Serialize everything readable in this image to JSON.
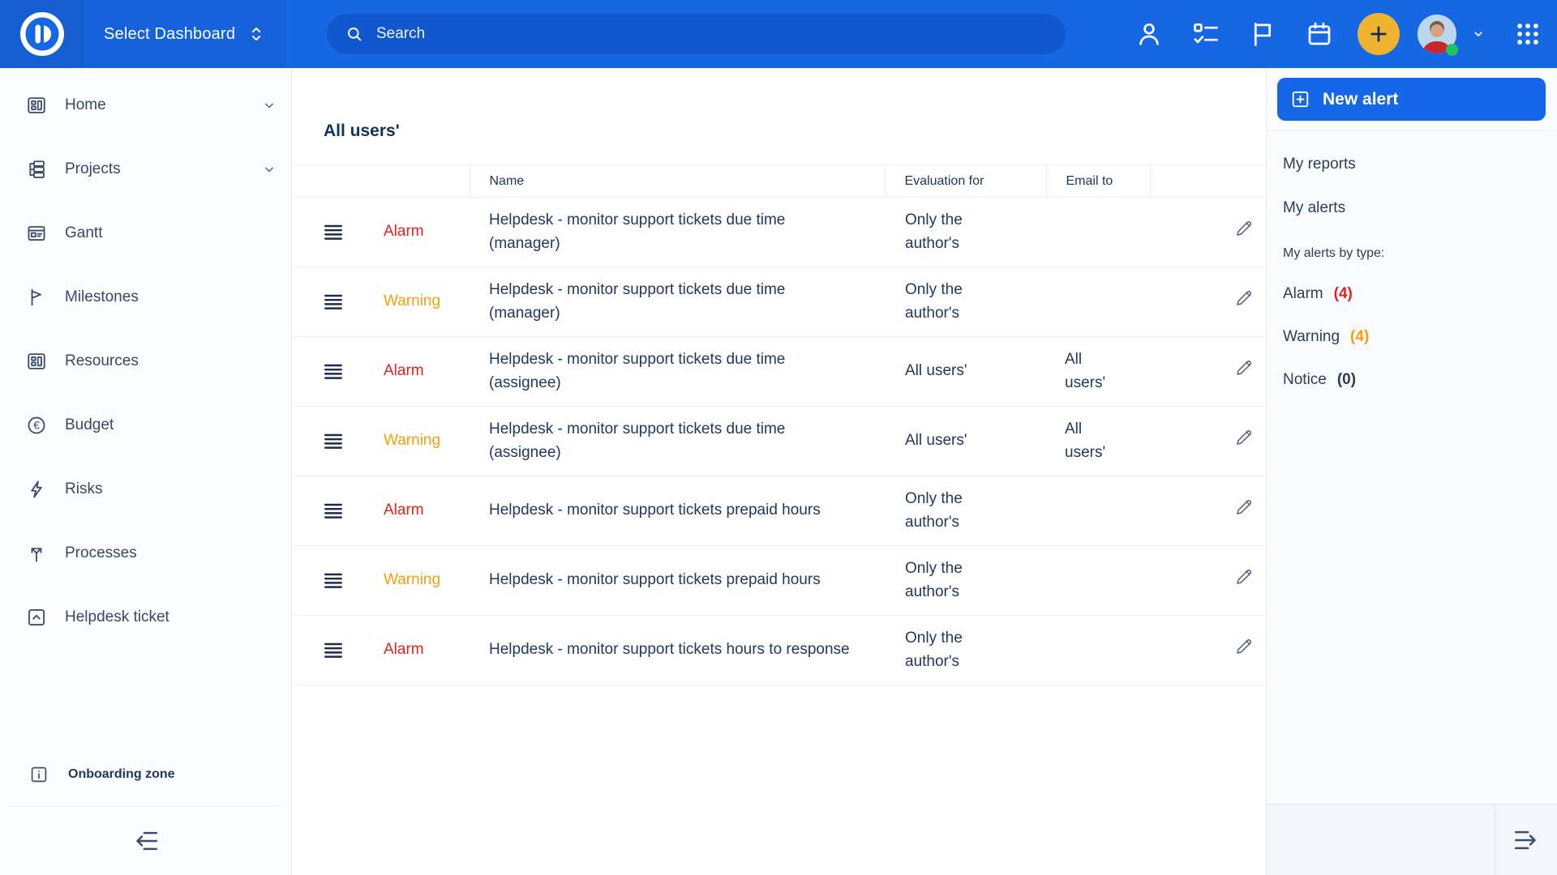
{
  "colors": {
    "header-blue": "#1667E4",
    "search-pill": "#1158CF",
    "accent-blue": "#1667E8",
    "plus-yellow": "#EFB42F",
    "alarm-red": "#E02121",
    "warning-orange": "#F59E0B",
    "navy-text": "#21395E",
    "sidebar-text": "#3A4767",
    "icon-slate": "#3F4D6C",
    "online-green": "#1FC55F"
  },
  "topbar": {
    "dashboard_selector_label": "Select Dashboard",
    "search_placeholder": "Search",
    "icon_names": [
      "user-icon",
      "todo-list-icon",
      "flag-icon",
      "calendar-icon",
      "plus-icon",
      "avatar",
      "chevron-down-icon",
      "apps-grid-icon"
    ]
  },
  "sidebar": {
    "items": [
      {
        "label": "Home",
        "icon": "dashboard-icon",
        "expandable": true
      },
      {
        "label": "Projects",
        "icon": "projects-tree-icon",
        "expandable": true
      },
      {
        "label": "Gantt",
        "icon": "gantt-icon"
      },
      {
        "label": "Milestones",
        "icon": "milestone-flag-icon"
      },
      {
        "label": "Resources",
        "icon": "resources-icon"
      },
      {
        "label": "Budget",
        "icon": "euro-circle-icon"
      },
      {
        "label": "Risks",
        "icon": "lightning-bolt-icon"
      },
      {
        "label": "Processes",
        "icon": "split-arrows-icon"
      },
      {
        "label": "Helpdesk ticket",
        "icon": "chevron-up-square-icon"
      }
    ],
    "onboarding_label": "Onboarding zone"
  },
  "main": {
    "title": "All users'",
    "table": {
      "columns": [
        "",
        "Name",
        "Evaluation for",
        "Email to",
        ""
      ],
      "rows": [
        {
          "severity": "Alarm",
          "severity_color": "#E02121",
          "name": "Helpdesk - monitor support tickets due time (manager)",
          "evaluation_for": "Only the author's",
          "email_to": ""
        },
        {
          "severity": "Warning",
          "severity_color": "#F59E0B",
          "name": "Helpdesk - monitor support tickets due time (manager)",
          "evaluation_for": "Only the author's",
          "email_to": ""
        },
        {
          "severity": "Alarm",
          "severity_color": "#E02121",
          "name": "Helpdesk - monitor support tickets due time (assignee)",
          "evaluation_for": "All users'",
          "email_to": "All users'"
        },
        {
          "severity": "Warning",
          "severity_color": "#F59E0B",
          "name": "Helpdesk - monitor support tickets due time (assignee)",
          "evaluation_for": "All users'",
          "email_to": "All users'"
        },
        {
          "severity": "Alarm",
          "severity_color": "#E02121",
          "name": "Helpdesk - monitor support tickets prepaid hours",
          "evaluation_for": "Only the author's",
          "email_to": ""
        },
        {
          "severity": "Warning",
          "severity_color": "#F59E0B",
          "name": "Helpdesk - monitor support tickets prepaid hours",
          "evaluation_for": "Only the author's",
          "email_to": ""
        },
        {
          "severity": "Alarm",
          "severity_color": "#E02121",
          "name": "Helpdesk - monitor support tickets hours to response",
          "evaluation_for": "Only the author's",
          "email_to": ""
        }
      ]
    }
  },
  "right_panel": {
    "new_alert_label": "New alert",
    "links": [
      {
        "label": "My reports"
      },
      {
        "label": "My alerts"
      }
    ],
    "by_type_label": "My alerts by type:",
    "type_counts": [
      {
        "label": "Alarm",
        "count": "(4)",
        "color": "#E02121"
      },
      {
        "label": "Warning",
        "count": "(4)",
        "color": "#F59E0B"
      },
      {
        "label": "Notice",
        "count": "(0)",
        "color": "#2E3C59"
      }
    ]
  }
}
